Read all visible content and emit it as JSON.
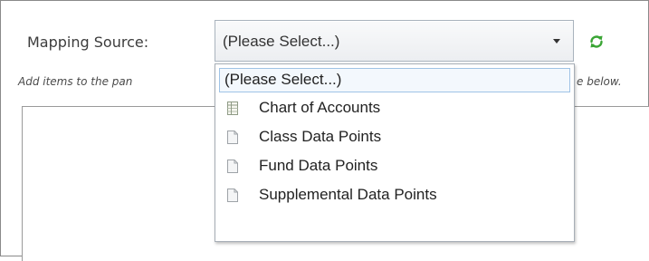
{
  "mapping_source": {
    "label": "Mapping Source:",
    "selected_value": "(Please Select...)"
  },
  "hint": {
    "text_start": "Add items to the pan",
    "text_end": "e below."
  },
  "dropdown": {
    "options": [
      {
        "label": "(Please Select...)",
        "icon": "none",
        "selected": true
      },
      {
        "label": "Chart of Accounts",
        "icon": "table-icon"
      },
      {
        "label": "Class Data Points",
        "icon": "document-icon"
      },
      {
        "label": "Fund Data Points",
        "icon": "document-icon"
      },
      {
        "label": "Supplemental Data Points",
        "icon": "document-icon"
      }
    ]
  },
  "colors": {
    "refresh_icon": "#3aa535",
    "selected_border": "#9fc3e6"
  }
}
